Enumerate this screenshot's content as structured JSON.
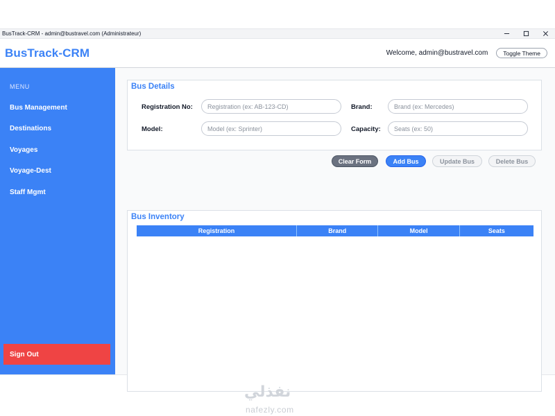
{
  "window": {
    "title": "BusTrack-CRM - admin@bustravel.com (Administrateur)"
  },
  "header": {
    "brand": "BusTrack-CRM",
    "welcome": "Welcome, admin@bustravel.com",
    "toggle_theme_label": "Toggle Theme"
  },
  "sidebar": {
    "menu_label": "MENU",
    "items": [
      {
        "label": "Bus Management"
      },
      {
        "label": "Destinations"
      },
      {
        "label": "Voyages"
      },
      {
        "label": "Voyage-Dest"
      },
      {
        "label": "Staff Mgmt"
      }
    ],
    "signout_label": "Sign Out"
  },
  "bus_details": {
    "title": "Bus Details",
    "fields": {
      "registration": {
        "label": "Registration No:",
        "placeholder": "Registration (ex: AB-123-CD)",
        "value": ""
      },
      "brand": {
        "label": "Brand:",
        "placeholder": "Brand (ex: Mercedes)",
        "value": ""
      },
      "model": {
        "label": "Model:",
        "placeholder": "Model (ex: Sprinter)",
        "value": ""
      },
      "capacity": {
        "label": "Capacity:",
        "placeholder": "Seats (ex: 50)",
        "value": ""
      }
    }
  },
  "actions": {
    "clear_label": "Clear Form",
    "add_label": "Add Bus",
    "update_label": "Update Bus",
    "delete_label": "Delete Bus"
  },
  "inventory": {
    "title": "Bus Inventory",
    "columns": [
      "Registration",
      "Brand",
      "Model",
      "Seats"
    ],
    "rows": []
  },
  "watermark": {
    "arabic": "نفذلي",
    "latin": "nafezly.com"
  },
  "colors": {
    "accent": "#3b82f6",
    "danger": "#ef4444",
    "neutral": "#6b7280"
  }
}
